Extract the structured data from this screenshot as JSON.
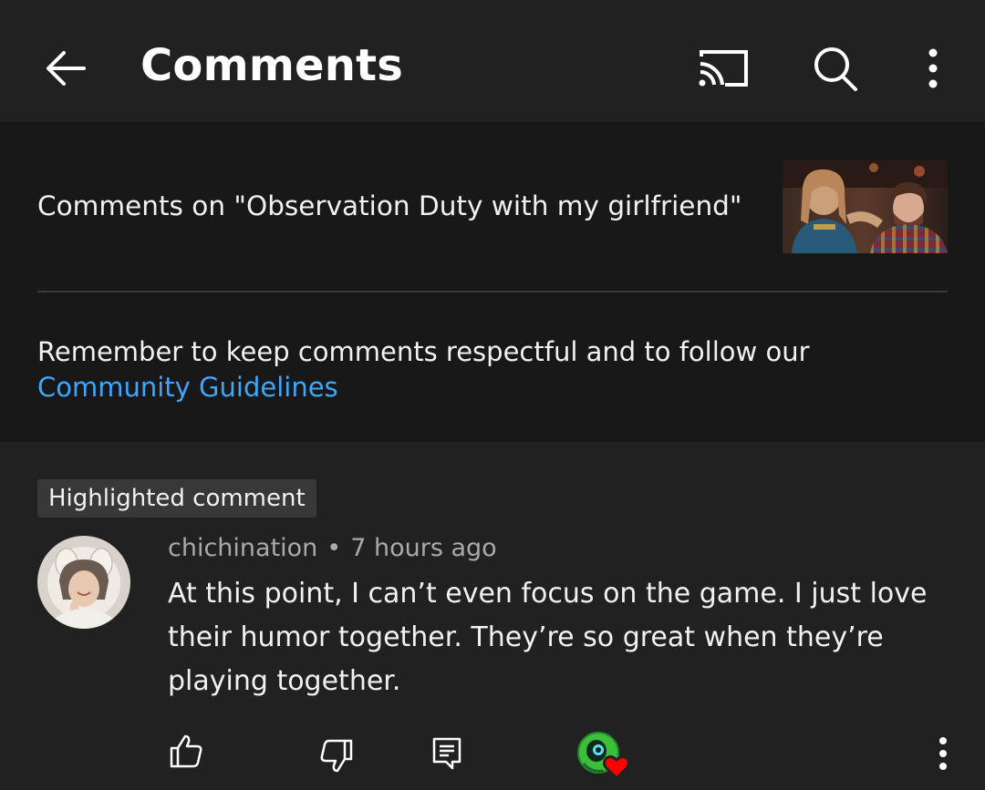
{
  "appbar": {
    "title": "Comments",
    "icons": [
      "back-arrow-icon",
      "cast-icon",
      "search-icon",
      "more-vert-icon"
    ]
  },
  "info": {
    "title": "Comments on \"Observation Duty with my girlfriend\"",
    "guideline_text": "Remember to keep comments respectful and to follow our",
    "guideline_link": "Community Guidelines"
  },
  "comment": {
    "badge": "Highlighted comment",
    "author": "chichination",
    "separator": "•",
    "time": "7 hours ago",
    "text": "At this point, I can’t even focus on the game. I just love their humor together. They’re so great when they’re playing together.",
    "actions": [
      "like-icon",
      "dislike-icon",
      "reply-icon",
      "creator-heart-icon",
      "more-vert-icon"
    ]
  },
  "colors": {
    "background": "#212121",
    "panel": "#181818",
    "link": "#3ea6ff",
    "heart": "#ff0000",
    "creator_avatar": "#3cbf3c"
  }
}
